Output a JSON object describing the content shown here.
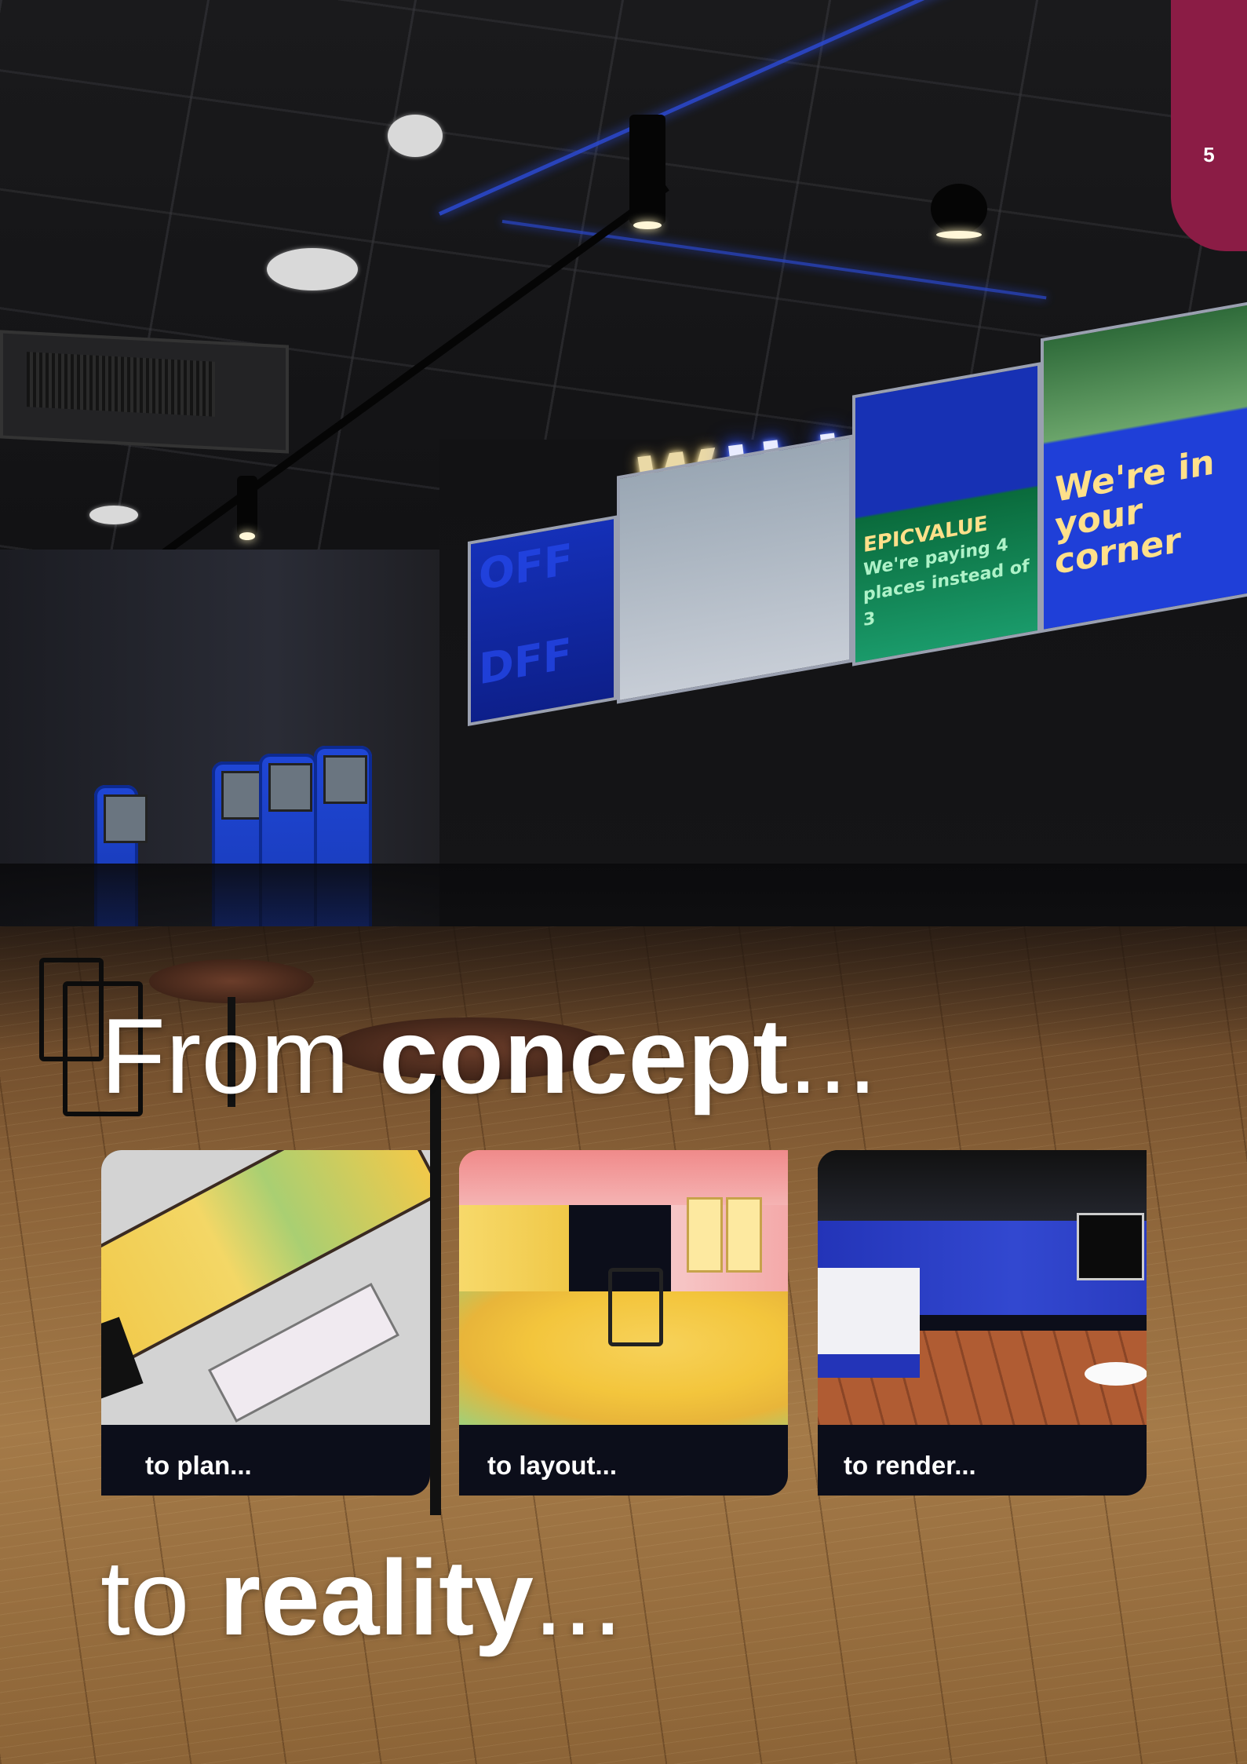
{
  "page": {
    "number": "5"
  },
  "colors": {
    "tab": "#8b1c45",
    "card_caption_bg": "#0c0e1a",
    "text": "#ffffff"
  },
  "headline_top": {
    "light": "From ",
    "bold": "concept",
    "trail": "..."
  },
  "headline_bottom": {
    "light": "to ",
    "bold": "reality",
    "trail": "..."
  },
  "cards": [
    {
      "caption": "to plan..."
    },
    {
      "caption": "to layout..."
    },
    {
      "caption": "to render..."
    }
  ],
  "photo": {
    "logo": "WH LIVE",
    "screen_texts": [
      "OFF",
      "DFF",
      "EPICVALUE",
      "We're paying 4 places instead of 3",
      "We're in your corner"
    ]
  }
}
